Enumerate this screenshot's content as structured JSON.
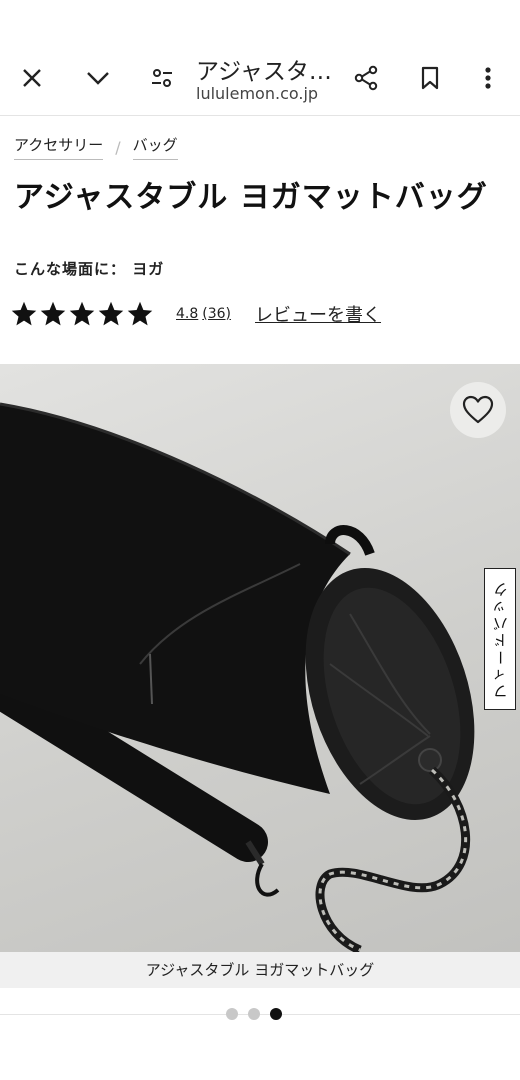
{
  "browser": {
    "page_title": "アジャスタ…",
    "url": "lululemon.co.jp"
  },
  "breadcrumb": {
    "items": [
      "アクセサリー",
      "バッグ"
    ],
    "separator": "/"
  },
  "product": {
    "title": "アジャスタブル ヨガマットバッグ",
    "occasion": "こんな場面に： ヨガ",
    "rating": 4.8,
    "rating_value": "4.8",
    "review_count": "(36)",
    "write_review": "レビューを書く",
    "image_caption": "アジャスタブル ヨガマットバッグ"
  },
  "feedback_tab": "フィードバック",
  "carousel": {
    "count": 3,
    "active": 3
  },
  "icons": {
    "close": "close-icon",
    "collapse": "chevron-down-icon",
    "site_settings": "tune-icon",
    "share": "share-icon",
    "bookmark": "bookmark-icon",
    "menu": "more-vert-icon",
    "favorite": "heart-icon",
    "star": "star-icon"
  }
}
